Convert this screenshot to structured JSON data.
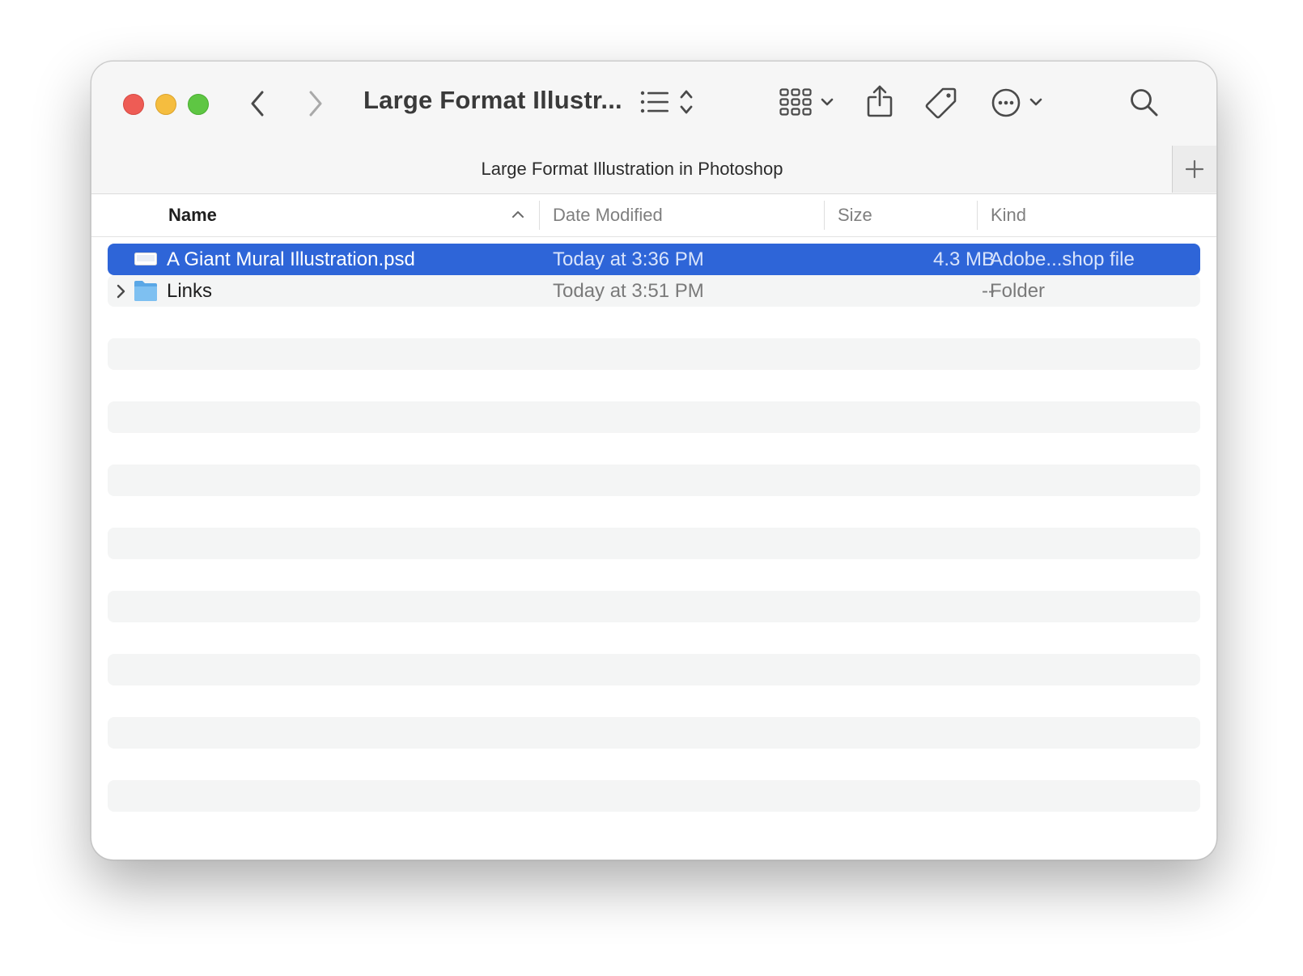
{
  "window": {
    "title": "Large Format Illustr...",
    "path_title": "Large Format Illustration in Photoshop"
  },
  "toolbar": {
    "icons": [
      "back-icon",
      "forward-icon",
      "list-view-icon",
      "sort-order-icon",
      "grid-view-icon",
      "share-icon",
      "tag-icon",
      "more-icon",
      "search-icon"
    ]
  },
  "columns": {
    "name": "Name",
    "date": "Date Modified",
    "size": "Size",
    "kind": "Kind",
    "sorted_by": "name",
    "sort_direction": "ascending"
  },
  "files": [
    {
      "name": "A Giant Mural Illustration.psd",
      "date": "Today at 3:36 PM",
      "size": "4.3 MB",
      "kind": "Adobe...shop file",
      "icon": "psd-file-icon",
      "selected": true
    },
    {
      "name": "Links",
      "date": "Today at 3:51 PM",
      "size": "--",
      "kind": "Folder",
      "icon": "folder-icon",
      "selected": false
    }
  ],
  "colors": {
    "selection": "#2e65d8",
    "close": "#ee5c55",
    "minimize": "#f5bd3f",
    "maximize": "#5ec643",
    "folder": "#6fb6ef"
  }
}
